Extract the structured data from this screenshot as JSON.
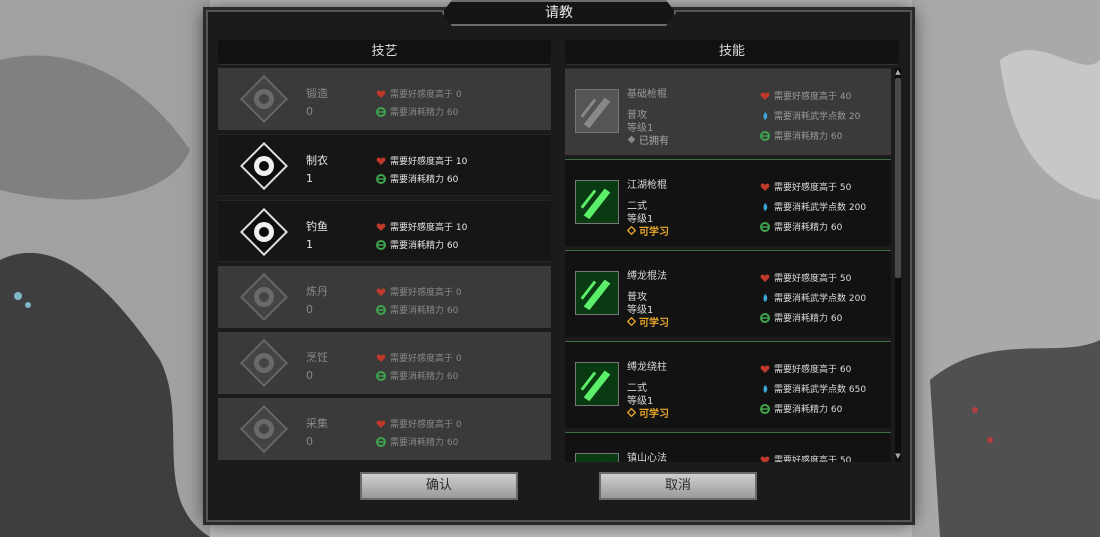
{
  "title": "请教",
  "left_panel": {
    "header": "技艺",
    "items": [
      {
        "name": "锻造",
        "level": "0",
        "req_affinity": "需要好感度高于 0",
        "req_energy": "需要消耗精力 60",
        "state": "dim",
        "icon": "anvil-icon"
      },
      {
        "name": "制衣",
        "level": "1",
        "req_affinity": "需要好感度高于 10",
        "req_energy": "需要消耗精力 60",
        "state": "active",
        "icon": "garment-icon"
      },
      {
        "name": "钓鱼",
        "level": "1",
        "req_affinity": "需要好感度高于 10",
        "req_energy": "需要消耗精力 60",
        "state": "active",
        "icon": "fish-icon"
      },
      {
        "name": "炼丹",
        "level": "0",
        "req_affinity": "需要好感度高于 0",
        "req_energy": "需要消耗精力 60",
        "state": "dim",
        "icon": "furnace-icon"
      },
      {
        "name": "烹饪",
        "level": "0",
        "req_affinity": "需要好感度高于 0",
        "req_energy": "需要消耗精力 60",
        "state": "dim",
        "icon": "bowl-icon"
      },
      {
        "name": "采集",
        "level": "0",
        "req_affinity": "需要好感度高于 0",
        "req_energy": "需要消耗精力 60",
        "state": "dim",
        "icon": "herb-hand-icon"
      }
    ]
  },
  "right_panel": {
    "header": "技能",
    "items": [
      {
        "name": "基础枪棍",
        "type": "普攻",
        "level": "等级1",
        "status": "已拥有",
        "status_kind": "have",
        "req_affinity": "需要好感度高于 40",
        "req_points": "需要消耗武学点数 20",
        "req_energy": "需要消耗精力 60",
        "owned": true
      },
      {
        "name": "江湖枪棍",
        "type": "二式",
        "level": "等级1",
        "status": "可学习",
        "status_kind": "learn",
        "req_affinity": "需要好感度高于 50",
        "req_points": "需要消耗武学点数 200",
        "req_energy": "需要消耗精力 60",
        "owned": false
      },
      {
        "name": "缚龙棍法",
        "type": "普攻",
        "level": "等级1",
        "status": "可学习",
        "status_kind": "learn",
        "req_affinity": "需要好感度高于 50",
        "req_points": "需要消耗武学点数 200",
        "req_energy": "需要消耗精力 60",
        "owned": false
      },
      {
        "name": "缚龙绕柱",
        "type": "二式",
        "level": "等级1",
        "status": "可学习",
        "status_kind": "learn",
        "req_affinity": "需要好感度高于 60",
        "req_points": "需要消耗武学点数 650",
        "req_energy": "需要消耗精力 60",
        "owned": false
      },
      {
        "name": "镇山心法",
        "type": "",
        "level": "",
        "status": "",
        "status_kind": "",
        "req_affinity": "需要好感度高于 50",
        "req_points": "",
        "req_energy": "",
        "owned": false
      }
    ]
  },
  "buttons": {
    "confirm": "确认",
    "cancel": "取消"
  },
  "colors": {
    "heart": "#c0392b",
    "energy": "#3fa34d",
    "points": "#3aa7d8",
    "learnable": "#e8a52a"
  }
}
